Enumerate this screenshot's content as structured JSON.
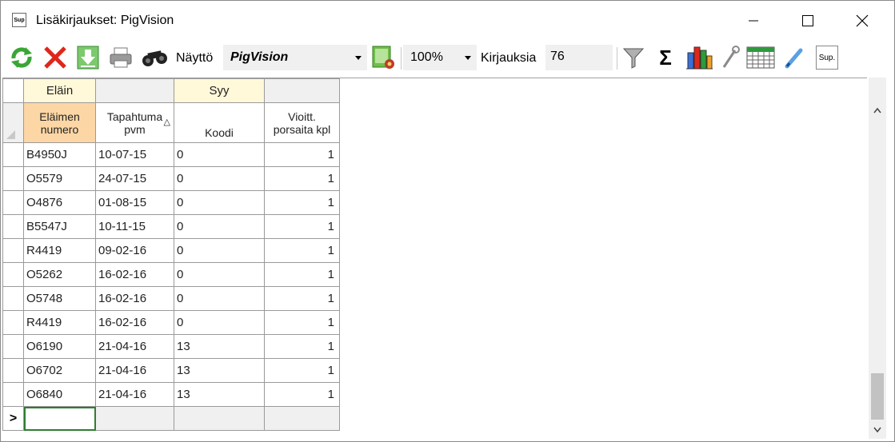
{
  "window": {
    "title": "Lisäkirjaukset: PigVision",
    "app_icon_text": "Sup",
    "controls": [
      "minimize-icon",
      "maximize-icon",
      "close-icon"
    ]
  },
  "toolbar": {
    "icons": [
      "refresh-icon",
      "delete-icon",
      "download-icon",
      "print-icon",
      "binoculars-icon"
    ],
    "view_label": "Näyttö",
    "view_value": "PigVision",
    "settings_icon": "report-settings-icon",
    "zoom_value": "100%",
    "records_label": "Kirjauksia",
    "records_value": "76",
    "right_icons": [
      "filter-icon",
      "sum-icon",
      "chart-icon",
      "wrench-icon",
      "calendar-icon",
      "pen-icon",
      "sup-icon"
    ],
    "sup_text": "Sup.",
    "sum_glyph": "Σ"
  },
  "grid": {
    "groups": [
      "Eläin",
      "",
      "Syy",
      ""
    ],
    "columns": [
      {
        "line1": "Eläimen",
        "line2": "numero"
      },
      {
        "line1": "Tapahtuma",
        "line2": "pvm"
      },
      {
        "line1": "",
        "line2": "Koodi"
      },
      {
        "line1": "Vioitt.",
        "line2": "porsaita kpl"
      }
    ],
    "rows": [
      [
        "B4950J",
        "10-07-15",
        "0",
        "1"
      ],
      [
        "O5579",
        "24-07-15",
        "0",
        "1"
      ],
      [
        "O4876",
        "01-08-15",
        "0",
        "1"
      ],
      [
        "B5547J",
        "10-11-15",
        "0",
        "1"
      ],
      [
        "R4419",
        "09-02-16",
        "0",
        "1"
      ],
      [
        "O5262",
        "16-02-16",
        "0",
        "1"
      ],
      [
        "O5748",
        "16-02-16",
        "0",
        "1"
      ],
      [
        "R4419",
        "16-02-16",
        "0",
        "1"
      ],
      [
        "O6190",
        "21-04-16",
        "13",
        "1"
      ],
      [
        "O6702",
        "21-04-16",
        "13",
        "1"
      ],
      [
        "O6840",
        "21-04-16",
        "13",
        "1"
      ]
    ],
    "new_row_marker": ">",
    "sort_glyph": "△"
  },
  "colors": {
    "group_header": "#fff8d9",
    "key_column_header": "#fcd7a5",
    "active_cell_border": "#2f7d32"
  }
}
